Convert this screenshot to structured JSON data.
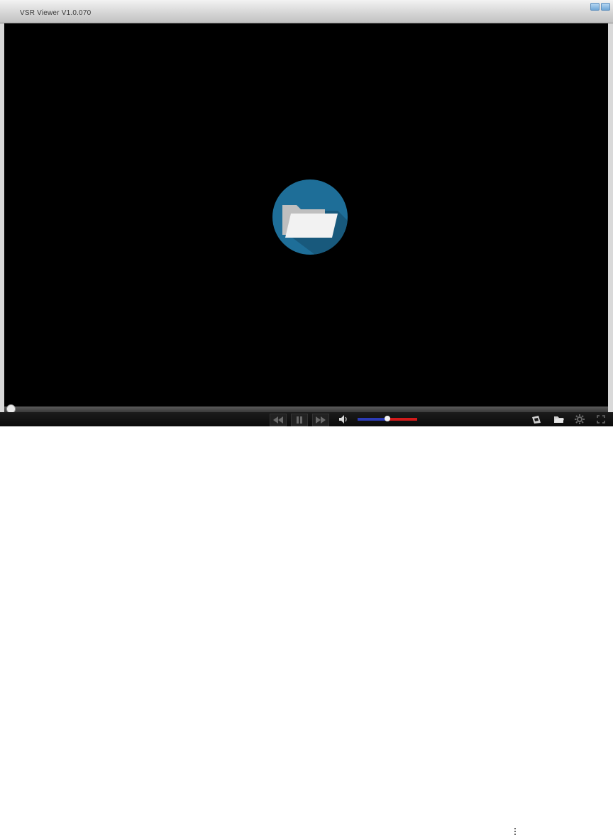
{
  "window": {
    "title": "VSR Viewer  V1.0.070"
  },
  "player": {
    "open_file_icon": "folder-open-icon",
    "seek_progress": 0.0,
    "volume_level": 0.5
  },
  "controls": {
    "rewind_icon": "rewind-icon",
    "pause_icon": "pause-icon",
    "forward_icon": "fast-forward-icon",
    "volume_icon": "speaker-icon",
    "snapshot_icon": "snapshot-icon",
    "folder_icon": "folder-icon",
    "settings_icon": "gear-icon",
    "fullscreen_icon": "fullscreen-icon"
  },
  "colors": {
    "accent": "#1e6e98",
    "volume_filled": "#2b3ab5",
    "volume_remaining": "#d11a1a"
  }
}
